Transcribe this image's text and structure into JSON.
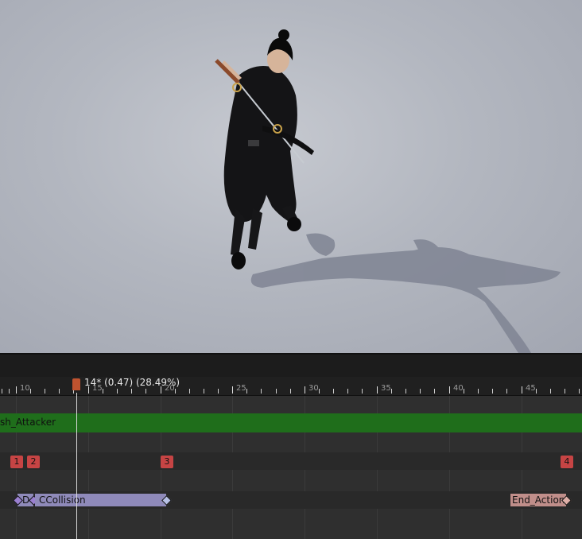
{
  "timeline": {
    "frame_readout": "14* (0.47) (28.49%)",
    "ruler_labels": [
      "10",
      "15",
      "20",
      "25",
      "30",
      "35",
      "40",
      "45"
    ],
    "playhead_frame": 14
  },
  "tracks": {
    "section_label": "sh_Attacker",
    "markers": [
      "1",
      "2",
      "3",
      "4"
    ],
    "notifies": {
      "d_label": "D",
      "collision_label": "CCollision",
      "end_label": "End_Action"
    }
  },
  "colors": {
    "section": "#1f6e1b",
    "marker": "#c64444",
    "playhead": "#c0532f",
    "collision_notify": "#8f8aba",
    "end_notify": "#c08e8a"
  }
}
